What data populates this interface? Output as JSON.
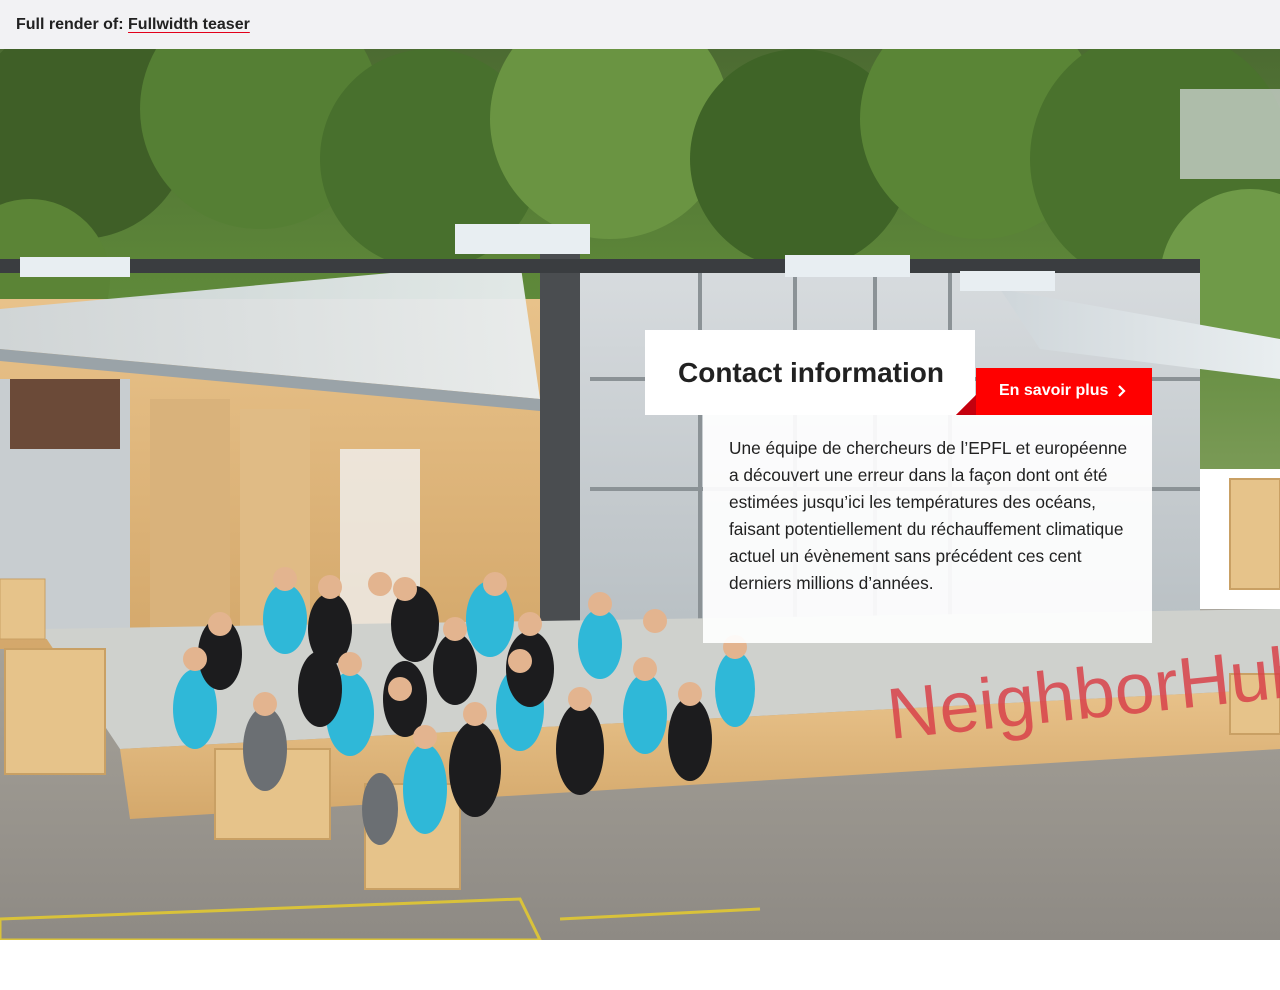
{
  "topbar": {
    "prefix": "Full render of:",
    "link": "Fullwidth teaser"
  },
  "teaser": {
    "title": "Contact information",
    "cta_label": "En savoir plus",
    "cta_icon": "chevron-right-icon",
    "description": "Une équipe de chercheurs de l’EPFL et européenne a découvert une erreur dans la façon dont ont été estimées jusqu’ici les températures des océans, faisant potentiellement du réchauffement climatique actuel un évènement sans précédent ces cent derniers millions d’années.",
    "image_sign": "NeighborHub"
  },
  "colors": {
    "accent": "#ff0000",
    "accent_dark": "#c4000e",
    "topbar_bg": "#f2f2f4",
    "text": "#212121"
  }
}
